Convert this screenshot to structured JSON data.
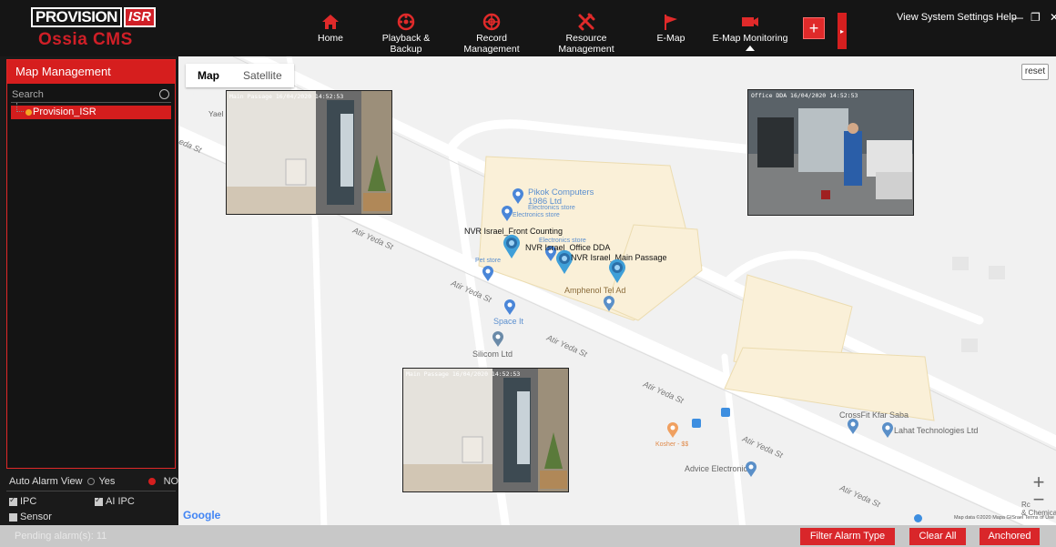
{
  "app": {
    "logo_text": "PROVISION",
    "logo_isr": "ISR",
    "logo_sub": "Ossia CMS"
  },
  "nav": [
    {
      "label": "Home",
      "icon": "home-icon"
    },
    {
      "label": "Playback & Backup",
      "icon": "playback-icon"
    },
    {
      "label": "Record Management",
      "icon": "record-icon"
    },
    {
      "label": "Resource Management",
      "icon": "resource-icon"
    },
    {
      "label": "E-Map",
      "icon": "flag-icon"
    },
    {
      "label": "E-Map Monitoring",
      "icon": "camera-icon"
    }
  ],
  "system_menu": "View System Settings Help",
  "left_panel": {
    "title": "Map Management",
    "search_placeholder": "Search",
    "tree_item": "Provision_ISR",
    "auto_alarm_label": "Auto Alarm View",
    "yes_label": "Yes",
    "no_label": "NO",
    "checkboxes": {
      "ipc": "IPC",
      "ai_ipc": "AI IPC",
      "sensor": "Sensor"
    }
  },
  "map": {
    "tab_map": "Map",
    "tab_satellite": "Satellite",
    "reset": "reset",
    "zoom_in": "+",
    "zoom_out": "−",
    "google": "Google",
    "credits": "Map data ©2020 Mapa GISrael   Terms of Use",
    "streets": [
      "Atir Yeda St",
      "Atir Yeda St",
      "Atir Yeda St",
      "Atir Yeda St",
      "Atir Yeda St",
      "Atir Yeda St",
      "eda St"
    ],
    "labels": {
      "yael": "Yael S",
      "pikok": "Pikok Computers",
      "pikok2": "1986 Ltd",
      "electronics1": "Electronics store",
      "electronics2": "Electronics store",
      "electronics3": "Electronics store",
      "pet": "Pet store",
      "amphenol": "Amphenol Tel Ad",
      "space": "Space It",
      "silicom": "Silicom Ltd",
      "kosher": "Kosher - $$",
      "advice": "Advice Electronic",
      "crossfit": "CrossFit Kfar Saba",
      "lahat": "Lahat Technologies Ltd",
      "rc": "Rc",
      "chemica": "& Chemica"
    },
    "markers": {
      "front": "NVR Israel_Front Counting",
      "office": "NVR Israel_Office DDA",
      "main": "NVR Israel_Main Passage"
    },
    "videos": {
      "v1_osd": "Main Passage   16/04/2020 14:52:53",
      "v2_osd": "Office DDA       16/04/2020 14:52:53",
      "v3_osd": "Main Passage   16/04/2020 14:52:53"
    }
  },
  "bottom": {
    "pending": "Pending alarm(s): 11",
    "filter": "Filter Alarm Type",
    "clear": "Clear All",
    "anchored": "Anchored"
  }
}
